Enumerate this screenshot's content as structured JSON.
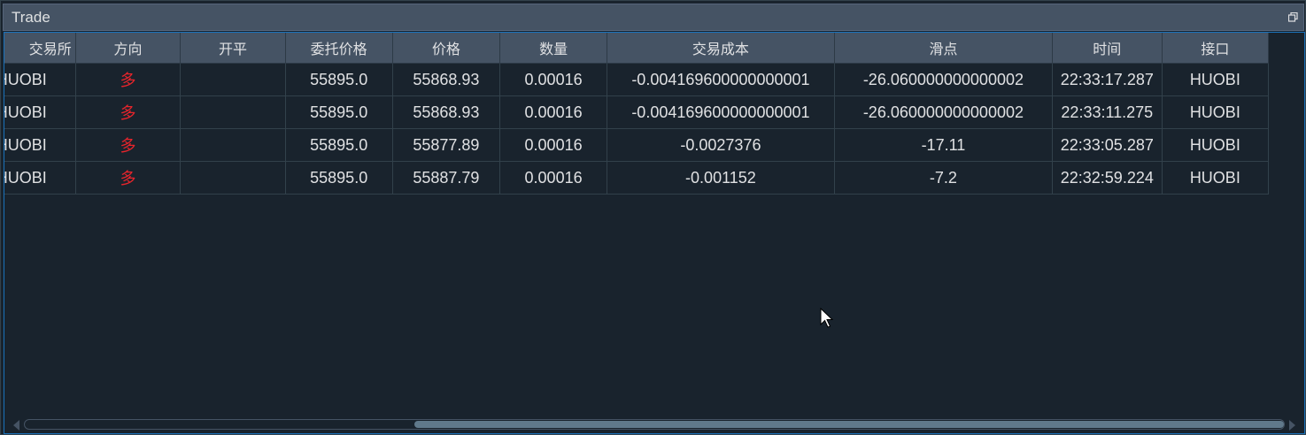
{
  "window": {
    "title": "Trade"
  },
  "table": {
    "headers": [
      "交易所",
      "方向",
      "开平",
      "委托价格",
      "价格",
      "数量",
      "交易成本",
      "滑点",
      "时间",
      "接口"
    ],
    "rows": [
      [
        "HUOBI",
        "多",
        "",
        "55895.0",
        "55868.93",
        "0.00016",
        "-0.004169600000000001",
        "-26.060000000000002",
        "22:33:17.287",
        "HUOBI"
      ],
      [
        "HUOBI",
        "多",
        "",
        "55895.0",
        "55868.93",
        "0.00016",
        "-0.004169600000000001",
        "-26.060000000000002",
        "22:33:11.275",
        "HUOBI"
      ],
      [
        "HUOBI",
        "多",
        "",
        "55895.0",
        "55877.89",
        "0.00016",
        "-0.0027376",
        "-17.11",
        "22:33:05.287",
        "HUOBI"
      ],
      [
        "HUOBI",
        "多",
        "",
        "55895.0",
        "55887.79",
        "0.00016",
        "-0.001152",
        "-7.2",
        "22:32:59.224",
        "HUOBI"
      ]
    ]
  },
  "scrollbar": {
    "horizontal_position": 0.31
  },
  "colors": {
    "background": "#19232d",
    "header": "#455364",
    "direction_long": "#e8242b",
    "panel_border": "#1a72bb"
  },
  "icons": {
    "title_button": "float-window-icon",
    "cursor": "mouse-pointer-icon"
  }
}
